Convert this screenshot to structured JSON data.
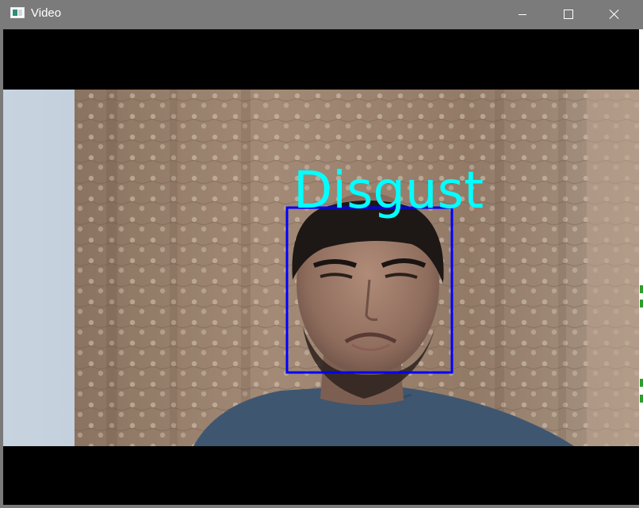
{
  "window": {
    "title": "Video",
    "icon": "app-window-icon",
    "controls": {
      "minimize": "minimize-icon",
      "maximize": "maximize-icon",
      "close": "close-icon"
    }
  },
  "video": {
    "emotion_label": "Disgust",
    "label_color": "#00ffff",
    "face_box_color": "#0000ff"
  }
}
